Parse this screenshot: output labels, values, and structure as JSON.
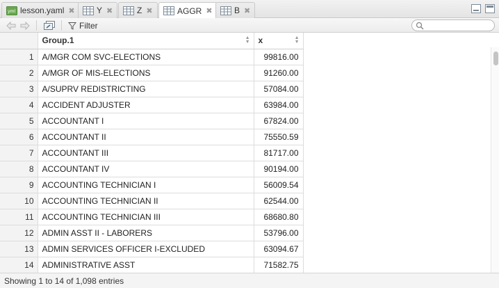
{
  "tabs": [
    {
      "label": "lesson.yaml",
      "icon": "yaml-file-icon",
      "active": false
    },
    {
      "label": "Y",
      "icon": "table-icon",
      "active": false
    },
    {
      "label": "Z",
      "icon": "table-icon",
      "active": false
    },
    {
      "label": "AGGR",
      "icon": "table-icon",
      "active": true
    },
    {
      "label": "B",
      "icon": "table-icon",
      "active": false
    }
  ],
  "toolbar": {
    "filter_label": "Filter",
    "search_placeholder": ""
  },
  "table": {
    "columns": [
      "",
      "Group.1",
      "x"
    ],
    "rows": [
      [
        "1",
        "A/MGR COM SVC-ELECTIONS",
        "99816.00"
      ],
      [
        "2",
        "A/MGR OF MIS-ELECTIONS",
        "91260.00"
      ],
      [
        "3",
        "A/SUPRV REDISTRICTING",
        "57084.00"
      ],
      [
        "4",
        "ACCIDENT ADJUSTER",
        "63984.00"
      ],
      [
        "5",
        "ACCOUNTANT I",
        "67824.00"
      ],
      [
        "6",
        "ACCOUNTANT II",
        "75550.59"
      ],
      [
        "7",
        "ACCOUNTANT III",
        "81717.00"
      ],
      [
        "8",
        "ACCOUNTANT IV",
        "90194.00"
      ],
      [
        "9",
        "ACCOUNTING TECHNICIAN I",
        "56009.54"
      ],
      [
        "10",
        "ACCOUNTING TECHNICIAN II",
        "62544.00"
      ],
      [
        "11",
        "ACCOUNTING TECHNICIAN III",
        "68680.80"
      ],
      [
        "12",
        "ADMIN ASST II - LABORERS",
        "53796.00"
      ],
      [
        "13",
        "ADMIN SERVICES OFFICER I-EXCLUDED",
        "63094.67"
      ],
      [
        "14",
        "ADMINISTRATIVE ASST",
        "71582.75"
      ]
    ]
  },
  "footer": {
    "status": "Showing 1 to 14 of 1,098 entries"
  },
  "colors": {
    "accent": "#5b8bb5",
    "yaml_icon": "#6aa84f"
  }
}
